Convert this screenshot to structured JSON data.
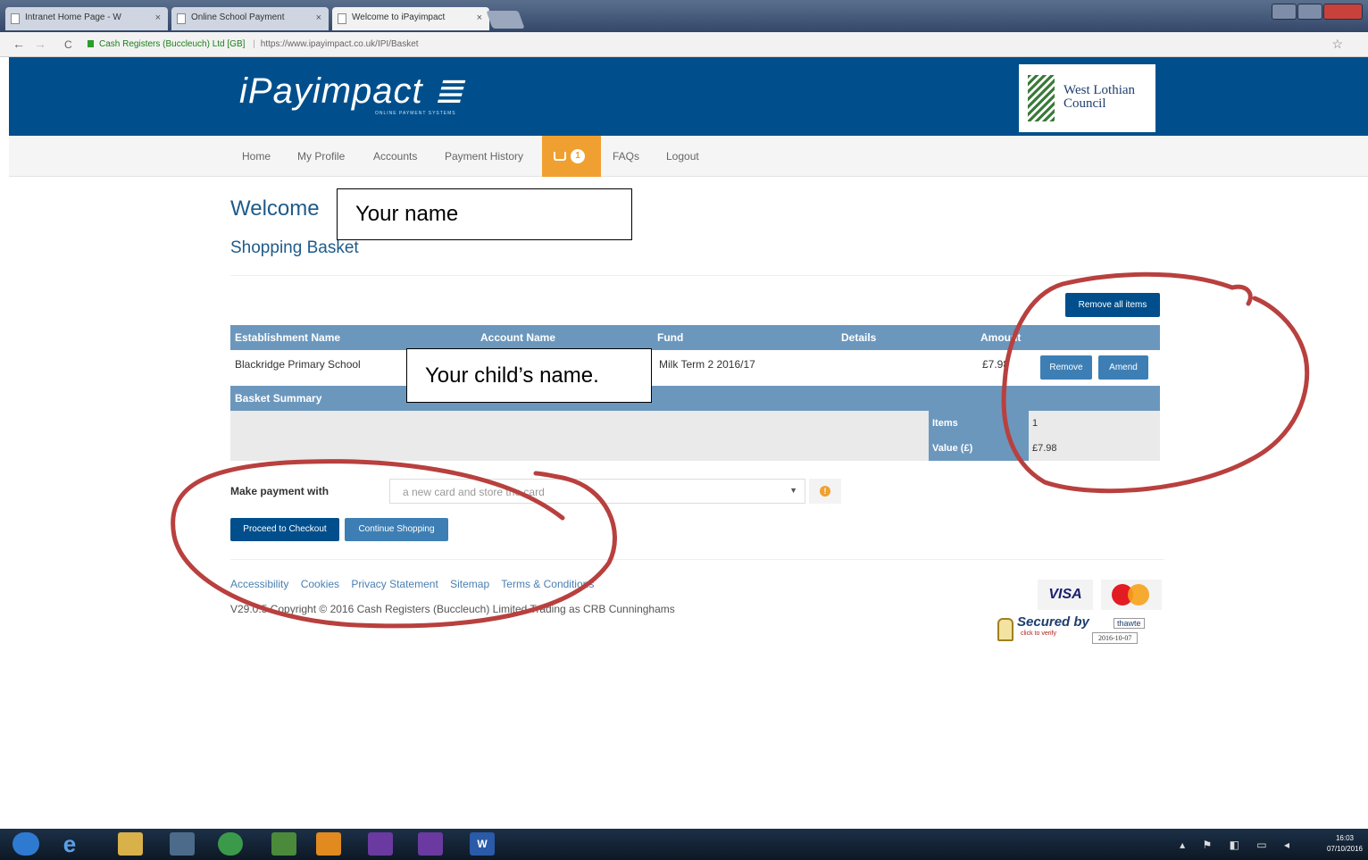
{
  "browser": {
    "tabs": [
      {
        "title": "Intranet Home Page - W"
      },
      {
        "title": "Online School Payment"
      },
      {
        "title": "Welcome to iPayimpact"
      }
    ],
    "address": {
      "secure_label": "Cash Registers (Buccleuch) Ltd [GB]",
      "url": "https://www.ipayimpact.co.uk/IPI/Basket"
    }
  },
  "site": {
    "logo_text": "iPayimpact",
    "logo_subtitle": "ONLINE PAYMENT SYSTEMS",
    "council_line1": "West Lothian",
    "council_line2": "Council"
  },
  "nav": {
    "items": [
      "Home",
      "My Profile",
      "Accounts",
      "Payment History",
      "FAQs",
      "Logout"
    ],
    "basket_count": "1"
  },
  "page": {
    "welcome": "Welcome",
    "heading": "Shopping Basket",
    "remove_all_label": "Remove all items"
  },
  "table": {
    "headers": [
      "Establishment Name",
      "Account Name",
      "Fund",
      "Details",
      "Amount"
    ],
    "row": {
      "establishment": "Blackridge Primary School",
      "fund": "Milk Term 2 2016/17",
      "amount": "£7.98",
      "remove_label": "Remove",
      "amend_label": "Amend"
    },
    "summary_title": "Basket Summary",
    "summary": [
      {
        "label": "Items",
        "value": "1"
      },
      {
        "label": "Value (£)",
        "value": "£7.98"
      }
    ]
  },
  "payment": {
    "label": "Make payment with",
    "selected": "a new card and store the card",
    "checkout_label": "Proceed to Checkout",
    "continue_label": "Continue Shopping"
  },
  "footer": {
    "links": [
      "Accessibility",
      "Cookies",
      "Privacy Statement",
      "Sitemap",
      "Terms & Conditions"
    ],
    "copyright": "V29.0.5 Copyright © 2016 Cash Registers (Buccleuch) Limited Trading as CRB Cunninghams",
    "card_visa": "VISA",
    "seal_text": "Secured by",
    "seal_brand": "thawte",
    "seal_verify": "click to verify",
    "seal_date": "2016-10-07"
  },
  "annotations": {
    "your_name": "Your name",
    "child_name": "Your child’s name."
  },
  "taskbar": {
    "time": "16:03",
    "date": "07/10/2016"
  },
  "colors": {
    "brand_blue": "#004f8c",
    "table_header": "#6b97bd",
    "basket_orange": "#f0a030",
    "annotation_red": "#b8403e"
  }
}
